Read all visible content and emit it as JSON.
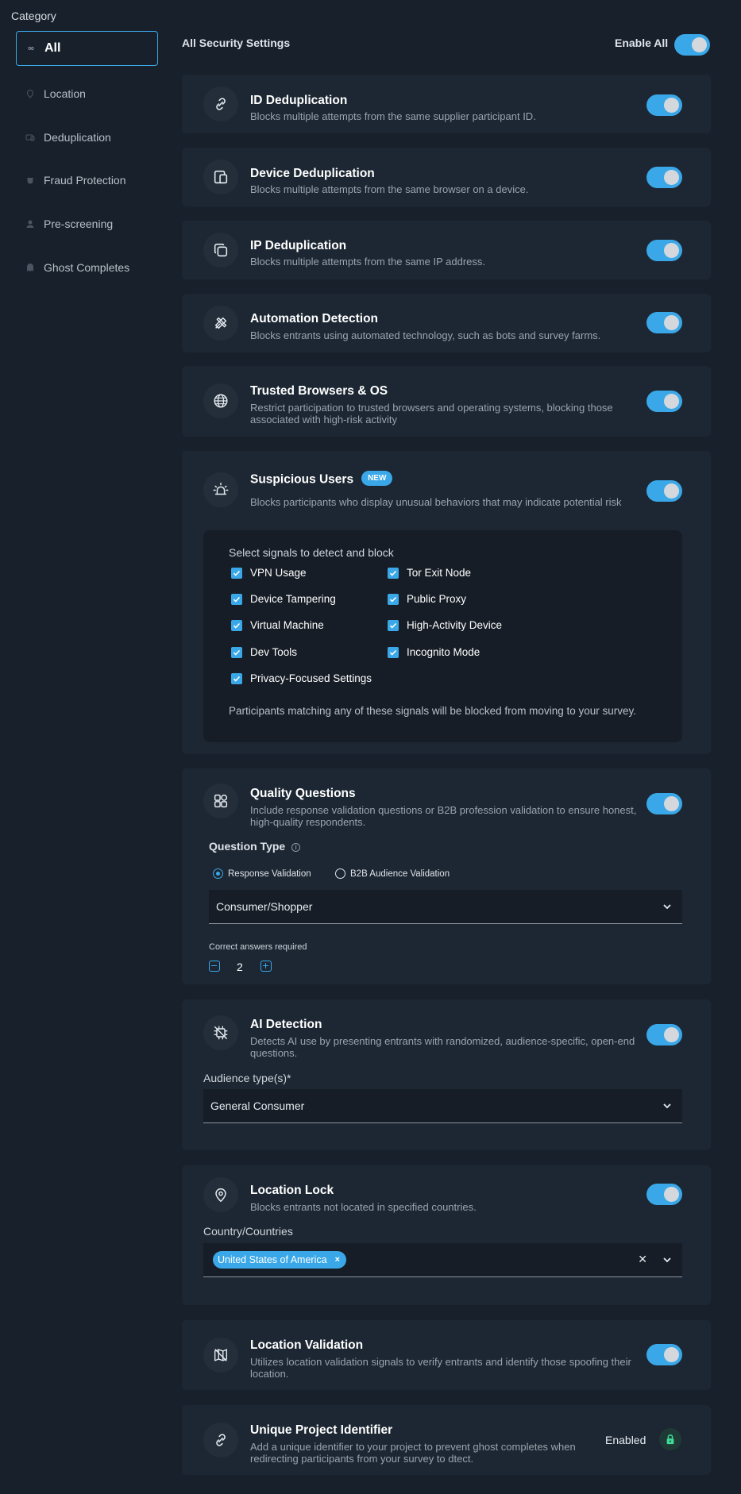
{
  "sidebar": {
    "title": "Category",
    "items": [
      {
        "label": "All",
        "icon": "infinity-icon"
      },
      {
        "label": "Location",
        "icon": "location-pin-icon"
      },
      {
        "label": "Deduplication",
        "icon": "dedup-icon"
      },
      {
        "label": "Fraud Protection",
        "icon": "bug-icon"
      },
      {
        "label": "Pre-screening",
        "icon": "user-icon"
      },
      {
        "label": "Ghost Completes",
        "icon": "ghost-icon"
      }
    ]
  },
  "header": {
    "title": "All Security Settings",
    "enable_all_label": "Enable All",
    "enable_all": true
  },
  "cards": {
    "id_dedup": {
      "title": "ID Deduplication",
      "desc": "Blocks multiple attempts from the same supplier participant ID."
    },
    "device_dedup": {
      "title": "Device Deduplication",
      "desc": "Blocks multiple attempts from the same browser on a device."
    },
    "ip_dedup": {
      "title": "IP Deduplication",
      "desc": "Blocks multiple attempts from the same IP address."
    },
    "automation": {
      "title": "Automation Detection",
      "desc": "Blocks entrants using automated technology, such as bots and survey farms."
    },
    "browsers": {
      "title": "Trusted Browsers & OS",
      "desc": "Restrict participation to trusted browsers and operating systems, blocking those associated with high-risk activity"
    },
    "suspicious": {
      "title": "Suspicious Users",
      "badge": "NEW",
      "desc": "Blocks participants who display unusual behaviors that may indicate potential risk",
      "signals_title": "Select signals to detect and block",
      "signals": [
        "VPN Usage",
        "Tor Exit Node",
        "Device Tampering",
        "Public Proxy",
        "Virtual Machine",
        "High-Activity Device",
        "Dev Tools",
        "Incognito Mode",
        "Privacy-Focused Settings"
      ],
      "note": "Participants matching any of these signals will be blocked from moving to your survey."
    },
    "quality": {
      "title": "Quality Questions",
      "desc": "Include response validation questions or B2B profession validation to ensure honest, high-quality respondents.",
      "question_type_label": "Question Type",
      "radio_1": "Response Validation",
      "radio_2": "B2B Audience Validation",
      "select_value": "Consumer/Shopper",
      "correct_label": "Correct answers required",
      "correct_value": "2"
    },
    "ai": {
      "title": "AI Detection",
      "desc": "Detects AI use by presenting entrants with randomized, audience-specific, open-end questions.",
      "audience_label": "Audience type(s)*",
      "audience_value": "General Consumer"
    },
    "location_lock": {
      "title": "Location Lock",
      "desc": "Blocks entrants not located in specified countries.",
      "country_label": "Country/Countries",
      "chip": "United States of America",
      "chip_remove": "×",
      "clear": "✕"
    },
    "location_validation": {
      "title": "Location Validation",
      "desc": "Utilizes location validation signals to verify entrants and identify those spoofing their location."
    },
    "unique_id": {
      "title": "Unique Project Identifier",
      "desc": "Add a unique identifier to your project to prevent ghost completes when redirecting participants from your survey to dtect.",
      "status": "Enabled"
    }
  },
  "colors": {
    "accent": "#3aa8e8",
    "background": "#18202b",
    "card": "#1d2733",
    "lock": "#3ddc97"
  }
}
